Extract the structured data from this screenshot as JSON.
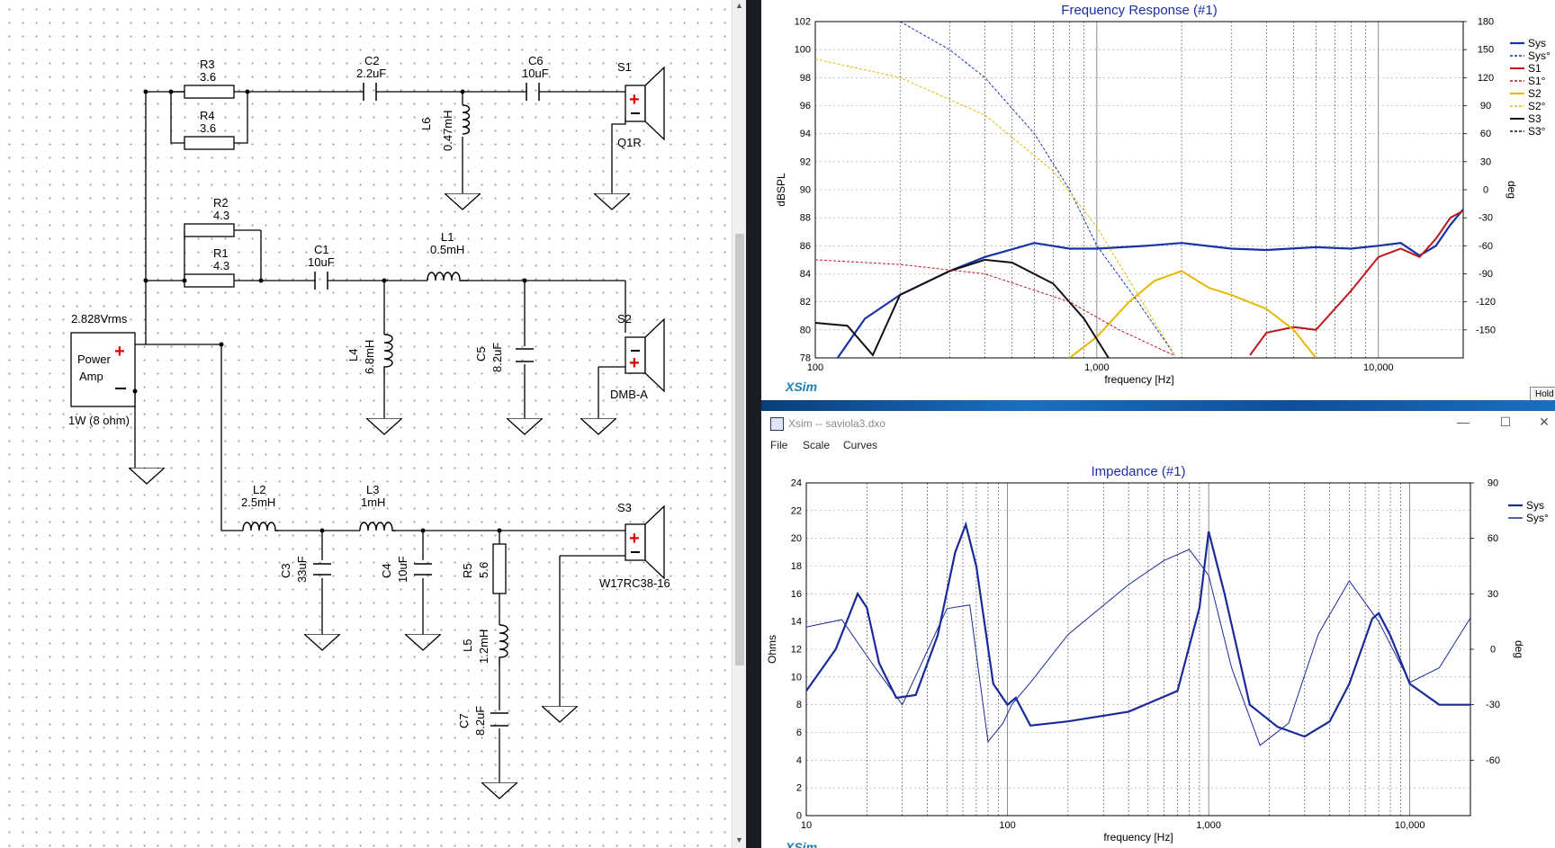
{
  "schematic": {
    "source": {
      "voltage": "2.828Vrms",
      "label_line1": "Power",
      "label_line2": "Amp",
      "power": "1W (8 ohm)"
    },
    "components": {
      "r3": {
        "name": "R3",
        "value": "3.6"
      },
      "r4": {
        "name": "R4",
        "value": "3.6"
      },
      "c2": {
        "name": "C2",
        "value": "2.2uF"
      },
      "c6": {
        "name": "C6",
        "value": "10uF"
      },
      "l6": {
        "name": "L6",
        "value": "0.47mH"
      },
      "r2": {
        "name": "R2",
        "value": "4.3"
      },
      "r1": {
        "name": "R1",
        "value": "4.3"
      },
      "c1": {
        "name": "C1",
        "value": "10uF"
      },
      "l1": {
        "name": "L1",
        "value": "0.5mH"
      },
      "l4": {
        "name": "L4",
        "value": "6.8mH"
      },
      "c5": {
        "name": "C5",
        "value": "8.2uF"
      },
      "l2": {
        "name": "L2",
        "value": "2.5mH"
      },
      "l3": {
        "name": "L3",
        "value": "1mH"
      },
      "c3": {
        "name": "C3",
        "value": "33uF"
      },
      "c4": {
        "name": "C4",
        "value": "10uF"
      },
      "r5": {
        "name": "R5",
        "value": "5.6"
      },
      "l5": {
        "name": "L5",
        "value": "1.2mH"
      },
      "c7": {
        "name": "C7",
        "value": "8.2uF"
      }
    },
    "speakers": {
      "s1": {
        "name": "S1",
        "model": "Q1R"
      },
      "s2": {
        "name": "S2",
        "model": "DMB-A"
      },
      "s3": {
        "name": "S3",
        "model": "W17RC38-16"
      }
    }
  },
  "freq_response": {
    "title": "Frequency Response (#1)",
    "watermark": "XSim",
    "hold_label": "Hold",
    "legend": [
      "Sys",
      "Sys°",
      "S1",
      "S1°",
      "S2",
      "S2°",
      "S3",
      "S3°"
    ],
    "colors": {
      "Sys": "#1533a8",
      "S1": "#c0151a",
      "S2": "#e6b800",
      "S3": "#111111"
    }
  },
  "impedance_window": {
    "window_title": "Xsim -- saviola3.dxo",
    "menu": [
      "File",
      "Scale",
      "Curves"
    ],
    "title": "Impedance (#1)",
    "legend": [
      "Sys",
      "Sys°"
    ],
    "watermark": "XSim"
  },
  "chart_data": [
    {
      "type": "line",
      "title": "Frequency Response (#1)",
      "xlabel": "frequency [Hz]",
      "ylabel": "dBSPL",
      "y2label": "deg",
      "xscale": "log",
      "xlim": [
        100,
        20000
      ],
      "ylim": [
        78,
        102
      ],
      "y2lim": [
        -180,
        180
      ],
      "x_ticks": [
        "100",
        "1,000",
        "10,000"
      ],
      "y_ticks": [
        "78",
        "80",
        "82",
        "84",
        "86",
        "88",
        "90",
        "92",
        "94",
        "96",
        "98",
        "100",
        "102"
      ],
      "y2_ticks": [
        "-150",
        "-120",
        "-90",
        "-60",
        "-30",
        "0",
        "30",
        "60",
        "90",
        "120",
        "150",
        "180"
      ],
      "grid": true,
      "legend_position": "right",
      "series": [
        {
          "name": "Sys",
          "x": [
            120,
            150,
            200,
            300,
            400,
            600,
            800,
            1000,
            1500,
            2000,
            3000,
            4000,
            6000,
            8000,
            10000,
            12000,
            14000,
            16000,
            18000,
            20000
          ],
          "y": [
            78.0,
            80.8,
            82.5,
            84.2,
            85.2,
            86.2,
            85.8,
            85.8,
            86.0,
            86.2,
            85.8,
            85.7,
            85.9,
            85.8,
            86.0,
            86.2,
            85.3,
            86.0,
            87.5,
            88.6
          ]
        },
        {
          "name": "S1",
          "x": [
            3500,
            4000,
            5000,
            6000,
            7000,
            8000,
            10000,
            12000,
            14000,
            16000,
            18000,
            20000
          ],
          "y": [
            78.2,
            79.8,
            80.2,
            80.0,
            81.5,
            82.8,
            85.2,
            85.8,
            85.2,
            86.5,
            88.0,
            88.5
          ]
        },
        {
          "name": "S2",
          "x": [
            800,
            1000,
            1300,
            1600,
            2000,
            2500,
            3000,
            4000,
            5000,
            6000
          ],
          "y": [
            78.0,
            79.5,
            82.0,
            83.5,
            84.2,
            83.0,
            82.5,
            81.5,
            80.0,
            78.0
          ]
        },
        {
          "name": "S3",
          "x": [
            100,
            130,
            160,
            200,
            300,
            400,
            500,
            700,
            900,
            1100
          ],
          "y": [
            80.5,
            80.3,
            78.2,
            82.5,
            84.2,
            85.0,
            84.8,
            83.3,
            80.8,
            78.0
          ]
        },
        {
          "name": "Sys°",
          "x": [
            200,
            300,
            400,
            600,
            800,
            1000,
            1400,
            1900
          ],
          "y": [
            180,
            150,
            120,
            60,
            0,
            -60,
            -120,
            -178
          ]
        },
        {
          "name": "S1°",
          "x": [
            100,
            200,
            400,
            800,
            1200,
            1900
          ],
          "y": [
            -75,
            -80,
            -90,
            -120,
            -150,
            -178
          ]
        },
        {
          "name": "S2°",
          "x": [
            100,
            200,
            400,
            700,
            1000,
            1900
          ],
          "y": [
            140,
            120,
            80,
            20,
            -40,
            -178
          ]
        }
      ]
    },
    {
      "type": "line",
      "title": "Impedance (#1)",
      "xlabel": "frequency [Hz]",
      "ylabel": "Ohms",
      "y2label": "deg",
      "xscale": "log",
      "xlim": [
        10,
        20000
      ],
      "ylim": [
        0,
        24
      ],
      "y2lim": [
        -90,
        90
      ],
      "x_ticks": [
        "10",
        "100",
        "1,000",
        "10,000"
      ],
      "y_ticks": [
        "0",
        "2",
        "4",
        "6",
        "8",
        "10",
        "12",
        "14",
        "16",
        "18",
        "20",
        "22",
        "24"
      ],
      "y2_ticks": [
        "-60",
        "-30",
        "0",
        "30",
        "60",
        "90"
      ],
      "grid": true,
      "legend_position": "right",
      "series": [
        {
          "name": "Sys",
          "x": [
            10,
            14,
            18,
            20,
            23,
            28,
            35,
            45,
            55,
            62,
            70,
            85,
            100,
            110,
            130,
            200,
            400,
            700,
            900,
            1000,
            1200,
            1600,
            2200,
            3000,
            4000,
            5000,
            6500,
            7000,
            8000,
            10000,
            14000,
            20000
          ],
          "y": [
            9,
            12,
            16,
            15,
            11,
            8.5,
            8.7,
            13,
            19,
            21,
            18,
            9.5,
            8,
            8.5,
            6.5,
            6.8,
            7.5,
            9,
            15,
            20.5,
            16,
            8,
            6.4,
            5.7,
            6.8,
            9.5,
            14.2,
            14.6,
            13,
            9.5,
            8,
            8
          ]
        },
        {
          "name": "Sys°",
          "x": [
            10,
            15,
            22,
            30,
            50,
            65,
            80,
            95,
            105,
            130,
            200,
            400,
            600,
            800,
            1000,
            1300,
            1800,
            2500,
            3500,
            5000,
            7000,
            10000,
            14000,
            20000
          ],
          "y": [
            12,
            16,
            -10,
            -30,
            22,
            24,
            -50,
            -40,
            -30,
            -18,
            8,
            35,
            48,
            54,
            40,
            -10,
            -52,
            -40,
            8,
            37,
            15,
            -18,
            -10,
            17
          ]
        }
      ]
    }
  ]
}
